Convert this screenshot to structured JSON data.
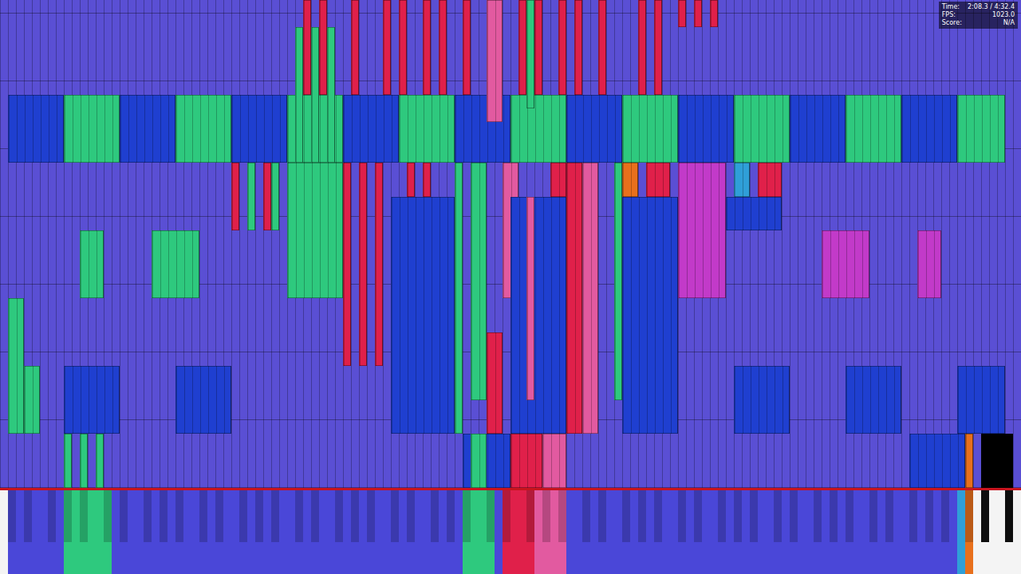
{
  "hud": [
    {
      "label": "Time:",
      "value": "2:08.3 / 4:32.4"
    },
    {
      "label": "FPS:",
      "value": "1023.0"
    },
    {
      "label": "Score:",
      "value": "N/A"
    }
  ],
  "roll": {
    "keys": 128,
    "beats_shown": 7.2,
    "base_color": "#5a4fd4"
  },
  "notes": [
    {
      "keys": [
        8,
        14
      ],
      "time": [
        4.8,
        5.8
      ],
      "color": "#2ec97e"
    },
    {
      "keys": [
        22,
        28
      ],
      "time": [
        4.8,
        5.8
      ],
      "color": "#2ec97e"
    },
    {
      "keys": [
        36,
        42
      ],
      "time": [
        4.8,
        5.8
      ],
      "color": "#2ec97e"
    },
    {
      "keys": [
        50,
        56
      ],
      "time": [
        4.8,
        5.8
      ],
      "color": "#2ec97e"
    },
    {
      "keys": [
        64,
        70
      ],
      "time": [
        4.8,
        5.8
      ],
      "color": "#2ec97e"
    },
    {
      "keys": [
        78,
        84
      ],
      "time": [
        4.8,
        5.8
      ],
      "color": "#2ec97e"
    },
    {
      "keys": [
        92,
        98
      ],
      "time": [
        4.8,
        5.8
      ],
      "color": "#2ec97e"
    },
    {
      "keys": [
        106,
        112
      ],
      "time": [
        4.8,
        5.8
      ],
      "color": "#2ec97e"
    },
    {
      "keys": [
        120,
        125
      ],
      "time": [
        4.8,
        5.8
      ],
      "color": "#2ec97e"
    },
    {
      "keys": [
        1,
        7
      ],
      "time": [
        4.8,
        5.8
      ],
      "color": "#1f3fd0"
    },
    {
      "keys": [
        15,
        21
      ],
      "time": [
        4.8,
        5.8
      ],
      "color": "#1f3fd0"
    },
    {
      "keys": [
        29,
        35
      ],
      "time": [
        4.8,
        5.8
      ],
      "color": "#1f3fd0"
    },
    {
      "keys": [
        43,
        49
      ],
      "time": [
        4.8,
        5.8
      ],
      "color": "#1f3fd0"
    },
    {
      "keys": [
        57,
        63
      ],
      "time": [
        4.8,
        5.8
      ],
      "color": "#1f3fd0"
    },
    {
      "keys": [
        71,
        77
      ],
      "time": [
        4.8,
        5.8
      ],
      "color": "#1f3fd0"
    },
    {
      "keys": [
        85,
        91
      ],
      "time": [
        4.8,
        5.8
      ],
      "color": "#1f3fd0"
    },
    {
      "keys": [
        99,
        105
      ],
      "time": [
        4.8,
        5.8
      ],
      "color": "#1f3fd0"
    },
    {
      "keys": [
        113,
        119
      ],
      "time": [
        4.8,
        5.8
      ],
      "color": "#1f3fd0"
    },
    {
      "keys": [
        38,
        38
      ],
      "time": [
        5.8,
        7.2
      ],
      "color": "#e0204a"
    },
    {
      "keys": [
        40,
        40
      ],
      "time": [
        5.8,
        7.2
      ],
      "color": "#e0204a"
    },
    {
      "keys": [
        44,
        44
      ],
      "time": [
        5.8,
        7.2
      ],
      "color": "#e0204a"
    },
    {
      "keys": [
        48,
        48
      ],
      "time": [
        5.8,
        7.2
      ],
      "color": "#e0204a"
    },
    {
      "keys": [
        50,
        50
      ],
      "time": [
        5.8,
        7.2
      ],
      "color": "#e0204a"
    },
    {
      "keys": [
        53,
        53
      ],
      "time": [
        5.8,
        7.2
      ],
      "color": "#e0204a"
    },
    {
      "keys": [
        55,
        55
      ],
      "time": [
        5.8,
        7.2
      ],
      "color": "#e0204a"
    },
    {
      "keys": [
        58,
        58
      ],
      "time": [
        5.8,
        7.2
      ],
      "color": "#e0204a"
    },
    {
      "keys": [
        65,
        65
      ],
      "time": [
        5.8,
        7.2
      ],
      "color": "#e0204a"
    },
    {
      "keys": [
        67,
        67
      ],
      "time": [
        5.8,
        7.2
      ],
      "color": "#e0204a"
    },
    {
      "keys": [
        70,
        70
      ],
      "time": [
        5.8,
        7.2
      ],
      "color": "#e0204a"
    },
    {
      "keys": [
        72,
        72
      ],
      "time": [
        5.8,
        7.2
      ],
      "color": "#e0204a"
    },
    {
      "keys": [
        75,
        75
      ],
      "time": [
        5.8,
        7.2
      ],
      "color": "#e0204a"
    },
    {
      "keys": [
        80,
        80
      ],
      "time": [
        5.8,
        7.2
      ],
      "color": "#e0204a"
    },
    {
      "keys": [
        82,
        82
      ],
      "time": [
        5.8,
        7.2
      ],
      "color": "#e0204a"
    },
    {
      "keys": [
        85,
        85
      ],
      "time": [
        6.8,
        7.2
      ],
      "color": "#e0204a"
    },
    {
      "keys": [
        87,
        87
      ],
      "time": [
        6.8,
        7.2
      ],
      "color": "#e0204a"
    },
    {
      "keys": [
        89,
        89
      ],
      "time": [
        6.8,
        7.2
      ],
      "color": "#e0204a"
    },
    {
      "keys": [
        37,
        37
      ],
      "time": [
        4.8,
        6.8
      ],
      "color": "#2ec97e"
    },
    {
      "keys": [
        39,
        39
      ],
      "time": [
        4.8,
        6.8
      ],
      "color": "#2ec97e"
    },
    {
      "keys": [
        41,
        41
      ],
      "time": [
        4.8,
        6.8
      ],
      "color": "#2ec97e"
    },
    {
      "keys": [
        66,
        66
      ],
      "time": [
        5.6,
        7.2
      ],
      "color": "#2ec97e"
    },
    {
      "keys": [
        61,
        62
      ],
      "time": [
        5.4,
        7.2
      ],
      "color": "#e25aa0"
    },
    {
      "keys": [
        29,
        29
      ],
      "time": [
        3.8,
        4.8
      ],
      "color": "#e0204a"
    },
    {
      "keys": [
        31,
        31
      ],
      "time": [
        3.8,
        4.8
      ],
      "color": "#2ec97e"
    },
    {
      "keys": [
        33,
        33
      ],
      "time": [
        3.8,
        4.8
      ],
      "color": "#e0204a"
    },
    {
      "keys": [
        34,
        34
      ],
      "time": [
        3.8,
        4.8
      ],
      "color": "#2ec97e"
    },
    {
      "keys": [
        36,
        42
      ],
      "time": [
        2.8,
        4.8
      ],
      "color": "#2ec97e"
    },
    {
      "keys": [
        43,
        43
      ],
      "time": [
        1.8,
        4.8
      ],
      "color": "#e0204a"
    },
    {
      "keys": [
        45,
        45
      ],
      "time": [
        1.8,
        4.8
      ],
      "color": "#e0204a"
    },
    {
      "keys": [
        47,
        47
      ],
      "time": [
        1.8,
        4.8
      ],
      "color": "#e0204a"
    },
    {
      "keys": [
        49,
        56
      ],
      "time": [
        0.8,
        4.3
      ],
      "color": "#1f3fd0"
    },
    {
      "keys": [
        51,
        51
      ],
      "time": [
        4.3,
        4.8
      ],
      "color": "#e0204a"
    },
    {
      "keys": [
        53,
        53
      ],
      "time": [
        4.3,
        4.8
      ],
      "color": "#e0204a"
    },
    {
      "keys": [
        57,
        57
      ],
      "time": [
        0.8,
        4.8
      ],
      "color": "#2ec97e"
    },
    {
      "keys": [
        59,
        60
      ],
      "time": [
        1.3,
        4.8
      ],
      "color": "#2ec97e"
    },
    {
      "keys": [
        61,
        62
      ],
      "time": [
        0.8,
        2.3
      ],
      "color": "#e0204a"
    },
    {
      "keys": [
        63,
        64
      ],
      "time": [
        2.8,
        4.8
      ],
      "color": "#e25aa0"
    },
    {
      "keys": [
        64,
        70
      ],
      "time": [
        0.8,
        4.3
      ],
      "color": "#1f3fd0"
    },
    {
      "keys": [
        66,
        66
      ],
      "time": [
        1.3,
        4.3
      ],
      "color": "#e25aa0"
    },
    {
      "keys": [
        69,
        70
      ],
      "time": [
        4.3,
        4.8
      ],
      "color": "#e0204a"
    },
    {
      "keys": [
        71,
        72
      ],
      "time": [
        0.8,
        4.8
      ],
      "color": "#e0204a"
    },
    {
      "keys": [
        73,
        74
      ],
      "time": [
        0.8,
        4.8
      ],
      "color": "#e25aa0"
    },
    {
      "keys": [
        77,
        77
      ],
      "time": [
        1.3,
        4.8
      ],
      "color": "#2ec97e"
    },
    {
      "keys": [
        78,
        79
      ],
      "time": [
        4.3,
        4.8
      ],
      "color": "#e8701c"
    },
    {
      "keys": [
        78,
        84
      ],
      "time": [
        0.8,
        4.3
      ],
      "color": "#1f3fd0"
    },
    {
      "keys": [
        81,
        83
      ],
      "time": [
        4.3,
        4.8
      ],
      "color": "#e0204a"
    },
    {
      "keys": [
        85,
        90
      ],
      "time": [
        2.8,
        4.8
      ],
      "color": "#c23ac9"
    },
    {
      "keys": [
        91,
        97
      ],
      "time": [
        3.8,
        4.3
      ],
      "color": "#1f3fd0"
    },
    {
      "keys": [
        92,
        93
      ],
      "time": [
        4.3,
        4.8
      ],
      "color": "#2f9fd8"
    },
    {
      "keys": [
        95,
        97
      ],
      "time": [
        4.3,
        4.8
      ],
      "color": "#e0204a"
    },
    {
      "keys": [
        10,
        12
      ],
      "time": [
        2.8,
        3.8
      ],
      "color": "#2ec97e"
    },
    {
      "keys": [
        19,
        24
      ],
      "time": [
        2.8,
        3.8
      ],
      "color": "#2ec97e"
    },
    {
      "keys": [
        103,
        108
      ],
      "time": [
        2.8,
        3.8
      ],
      "color": "#c23ac9"
    },
    {
      "keys": [
        115,
        117
      ],
      "time": [
        2.8,
        3.8
      ],
      "color": "#c23ac9"
    },
    {
      "keys": [
        1,
        2
      ],
      "time": [
        0.8,
        2.8
      ],
      "color": "#2ec97e"
    },
    {
      "keys": [
        3,
        4
      ],
      "time": [
        0.8,
        1.8
      ],
      "color": "#2ec97e"
    },
    {
      "keys": [
        8,
        14
      ],
      "time": [
        0.8,
        1.8
      ],
      "color": "#1f3fd0"
    },
    {
      "keys": [
        22,
        28
      ],
      "time": [
        0.8,
        1.8
      ],
      "color": "#1f3fd0"
    },
    {
      "keys": [
        92,
        98
      ],
      "time": [
        0.8,
        1.8
      ],
      "color": "#1f3fd0"
    },
    {
      "keys": [
        106,
        112
      ],
      "time": [
        0.8,
        1.8
      ],
      "color": "#1f3fd0"
    },
    {
      "keys": [
        120,
        125
      ],
      "time": [
        0.8,
        1.8
      ],
      "color": "#1f3fd0"
    },
    {
      "keys": [
        8,
        8
      ],
      "time": [
        0,
        0.8
      ],
      "color": "#2ec97e"
    },
    {
      "keys": [
        10,
        10
      ],
      "time": [
        0,
        0.8
      ],
      "color": "#2ec97e"
    },
    {
      "keys": [
        12,
        12
      ],
      "time": [
        0,
        0.8
      ],
      "color": "#2ec97e"
    },
    {
      "keys": [
        58,
        63
      ],
      "time": [
        0,
        0.8
      ],
      "color": "#1f3fd0"
    },
    {
      "keys": [
        59,
        60
      ],
      "time": [
        0,
        0.8
      ],
      "color": "#2ec97e"
    },
    {
      "keys": [
        64,
        67
      ],
      "time": [
        0,
        0.8
      ],
      "color": "#e0204a"
    },
    {
      "keys": [
        68,
        70
      ],
      "time": [
        0,
        0.8
      ],
      "color": "#e25aa0"
    },
    {
      "keys": [
        114,
        120
      ],
      "time": [
        0,
        0.8
      ],
      "color": "#1f3fd0"
    },
    {
      "keys": [
        121,
        121
      ],
      "time": [
        0,
        0.8
      ],
      "color": "#e8701c"
    },
    {
      "keys": [
        123,
        126
      ],
      "time": [
        0,
        0.8
      ],
      "color": "#000000"
    }
  ],
  "keyboard": {
    "pressed": [
      {
        "keys": [
          1,
          120
        ],
        "color": "#4a47d8"
      },
      {
        "keys": [
          8,
          13
        ],
        "color": "#2ec97e"
      },
      {
        "keys": [
          58,
          61
        ],
        "color": "#2ec97e"
      },
      {
        "keys": [
          63,
          66
        ],
        "color": "#e0204a"
      },
      {
        "keys": [
          67,
          70
        ],
        "color": "#e25aa0"
      },
      {
        "keys": [
          120,
          120
        ],
        "color": "#2f9fd8"
      },
      {
        "keys": [
          121,
          121
        ],
        "color": "#e8701c"
      }
    ]
  }
}
